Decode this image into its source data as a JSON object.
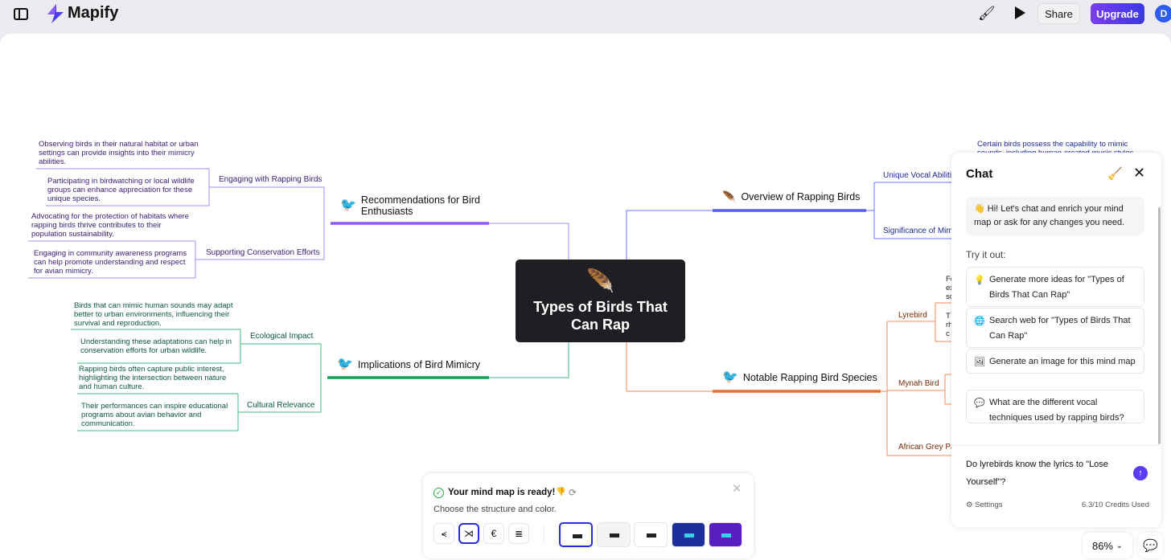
{
  "app": {
    "name": "Mapify"
  },
  "topbar": {
    "share": "Share",
    "upgrade": "Upgrade",
    "avatar": "D"
  },
  "colors": {
    "accent": "#5b3df5",
    "purple": "#8b5cf6",
    "green": "#0fa15a",
    "blue": "#4f5ff0",
    "orange": "#f06a2a",
    "center": "#1f1f23"
  },
  "map": {
    "center": "Types of Birds That Can Rap",
    "left": [
      {
        "title": "Recommendations for Bird Enthusiasts",
        "children": [
          {
            "title": "Engaging with Rapping Birds",
            "leaves": [
              "Observing birds in their natural habitat or urban settings can provide insights into their mimicry abilities.",
              "Participating in birdwatching or local wildlife groups can enhance appreciation for these unique species."
            ]
          },
          {
            "title": "Supporting Conservation Efforts",
            "leaves": [
              "Advocating for the protection of habitats where rapping birds thrive contributes to their population sustainability.",
              "Engaging in community awareness programs can help promote understanding and respect for avian mimicry."
            ]
          }
        ]
      },
      {
        "title": "Implications of Bird Mimicry",
        "children": [
          {
            "title": "Ecological Impact",
            "leaves": [
              "Birds that can mimic human sounds may adapt better to urban environments, influencing their survival and reproduction.",
              "Understanding these adaptations can help in conservation efforts for urban wildlife."
            ]
          },
          {
            "title": "Cultural Relevance",
            "leaves": [
              "Rapping birds often capture public interest, highlighting the intersection between nature and human culture.",
              "Their performances can inspire educational programs about avian behavior and communication."
            ]
          }
        ]
      }
    ],
    "right": [
      {
        "title": "Overview of Rapping Birds",
        "children": [
          {
            "title": "Unique Vocal Abilities",
            "leaves": [
              "Certain birds possess the capability to mimic sounds, including human-created music styles"
            ]
          },
          {
            "title": "Significance of Mimicry"
          }
        ]
      },
      {
        "title": "Notable Rapping Bird Species",
        "children": [
          {
            "title": "Lyrebird",
            "leaves": [
              "Fe\nex\nsc",
              "T\nrh\nc"
            ]
          },
          {
            "title": "Mynah Bird"
          },
          {
            "title": "African Grey Pa"
          }
        ]
      }
    ]
  },
  "chat": {
    "title": "Chat",
    "greeting": "👋 Hi! Let's chat and enrich your mind map or ask for any changes you need.",
    "try_label": "Try it out:",
    "suggestions": [
      {
        "icon": "lightbulb-icon",
        "text": "Generate more ideas for \"Types of Birds That Can Rap\""
      },
      {
        "icon": "globe-icon",
        "text": "Search web for \"Types of Birds That Can Rap\""
      },
      {
        "icon": "image-icon",
        "text": "Generate an image for this mind map"
      },
      {
        "icon": "chat-bubble-icon",
        "text": "What are the different vocal techniques used by rapping birds?"
      }
    ],
    "input": "Do lyrebirds know the lyrics to \"Lose Yourself\"?",
    "settings": "Settings",
    "credits": "6.3/10 Credits Used"
  },
  "ready": {
    "title": "Your mind map is ready!",
    "subtitle": "Choose the structure and color.",
    "structures": [
      "⪪",
      "⋊",
      "€",
      "≣"
    ],
    "selected_structure": 1,
    "selected_theme": 0
  },
  "zoom": "86%"
}
